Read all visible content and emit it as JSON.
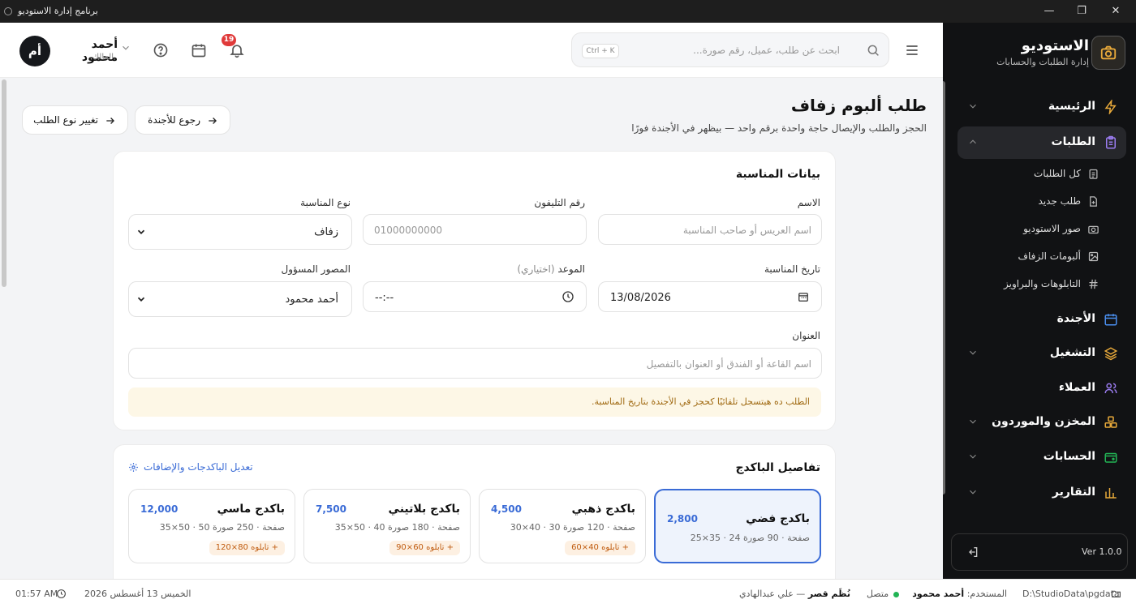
{
  "window": {
    "title": "برنامج إدارة الاستوديو"
  },
  "sidebar": {
    "brand_title": "الاستوديو",
    "brand_sub": "إدارة الطلبات والحسابات",
    "items": [
      {
        "label": "الرئيسية",
        "icon": "bolt-icon"
      },
      {
        "label": "الطلبات",
        "icon": "clipboard-icon"
      },
      {
        "label": "الأجندة",
        "icon": "calendar-icon"
      },
      {
        "label": "التشغيل",
        "icon": "layers-icon"
      },
      {
        "label": "العملاء",
        "icon": "users-icon"
      },
      {
        "label": "المخزن والموردون",
        "icon": "boxes-icon"
      },
      {
        "label": "الحسابات",
        "icon": "wallet-icon"
      },
      {
        "label": "التقارير",
        "icon": "chart-icon"
      }
    ],
    "sub_items": [
      {
        "label": "كل الطلبات"
      },
      {
        "label": "طلب جديد"
      },
      {
        "label": "صور الاستوديو"
      },
      {
        "label": "ألبومات الزفاف"
      },
      {
        "label": "التابلوهات والبراويز"
      }
    ],
    "version": "Ver 1.0.0"
  },
  "header": {
    "user_name": "أحمد محمود",
    "user_role": "المالك",
    "avatar_initials": "أم",
    "notifications_count": "19",
    "search_placeholder": "ابحث عن طلب، عميل، رقم صورة...",
    "search_shortcut": "Ctrl + K"
  },
  "page": {
    "title": "طلب ألبوم زفاف",
    "subtitle": "الحجز والطلب والإيصال حاجة واحدة برقم واحد — بيظهر في الأجندة فورًا",
    "back_button": "رجوع للأجندة",
    "change_type_button": "تغيير نوع الطلب"
  },
  "event": {
    "section_title": "بيانات المناسبة",
    "name_label": "الاسم",
    "name_placeholder": "اسم العريس أو صاحب المناسبة",
    "phone_label": "رقم التليفون",
    "phone_placeholder": "01000000000",
    "type_label": "نوع المناسبة",
    "type_value": "زفاف",
    "date_label": "تاريخ المناسبة",
    "date_value": "13/08/2026",
    "time_label": "الموعد",
    "time_optional": "(اختياري)",
    "time_value": "--:--",
    "photographer_label": "المصور المسؤول",
    "photographer_value": "أحمد محمود",
    "address_label": "العنوان",
    "address_placeholder": "اسم القاعة أو الفندق أو العنوان بالتفصيل",
    "note": "الطلب ده هيتسجل تلقائيًا كحجز في الأجندة بتاريخ المناسبة."
  },
  "packages": {
    "section_title": "تفاصيل الباكدج",
    "edit_link": "تعديل الباكدجات والإضافات",
    "items": [
      {
        "name": "باكدج فضي",
        "price": "2,800",
        "desc": "صفحة · 90 صورة 24 · 35×25",
        "tag": "",
        "selected": true
      },
      {
        "name": "باكدج ذهبي",
        "price": "4,500",
        "desc": "صفحة · 120 صورة 30 · 40×30",
        "tag": "+ تابلوه 40×60",
        "selected": false
      },
      {
        "name": "باكدج بلاتيني",
        "price": "7,500",
        "desc": "صفحة · 180 صورة 40 · 50×35",
        "tag": "+ تابلوه 60×90",
        "selected": false
      },
      {
        "name": "باكدج ماسي",
        "price": "12,000",
        "desc": "صفحة · 250 صورة 50 · 50×35",
        "tag": "+ تابلوه 80×120",
        "selected": false
      }
    ]
  },
  "status": {
    "path": "D:\\StudioData\\pgdata",
    "user_label": "المستخدم:",
    "user_value": "أحمد محمود",
    "connection": "متصل",
    "verse_strong": "نُظَم قصر",
    "verse_rest": "— علي عبدالهادي",
    "date": "الخميس 13 أغسطس 2026",
    "time": "01:57 AM"
  },
  "colors": {
    "accent": "#3a6bd6",
    "sidebar_bg": "#111214",
    "badge": "#e03a3a",
    "note_bg": "#fdf7e6"
  }
}
